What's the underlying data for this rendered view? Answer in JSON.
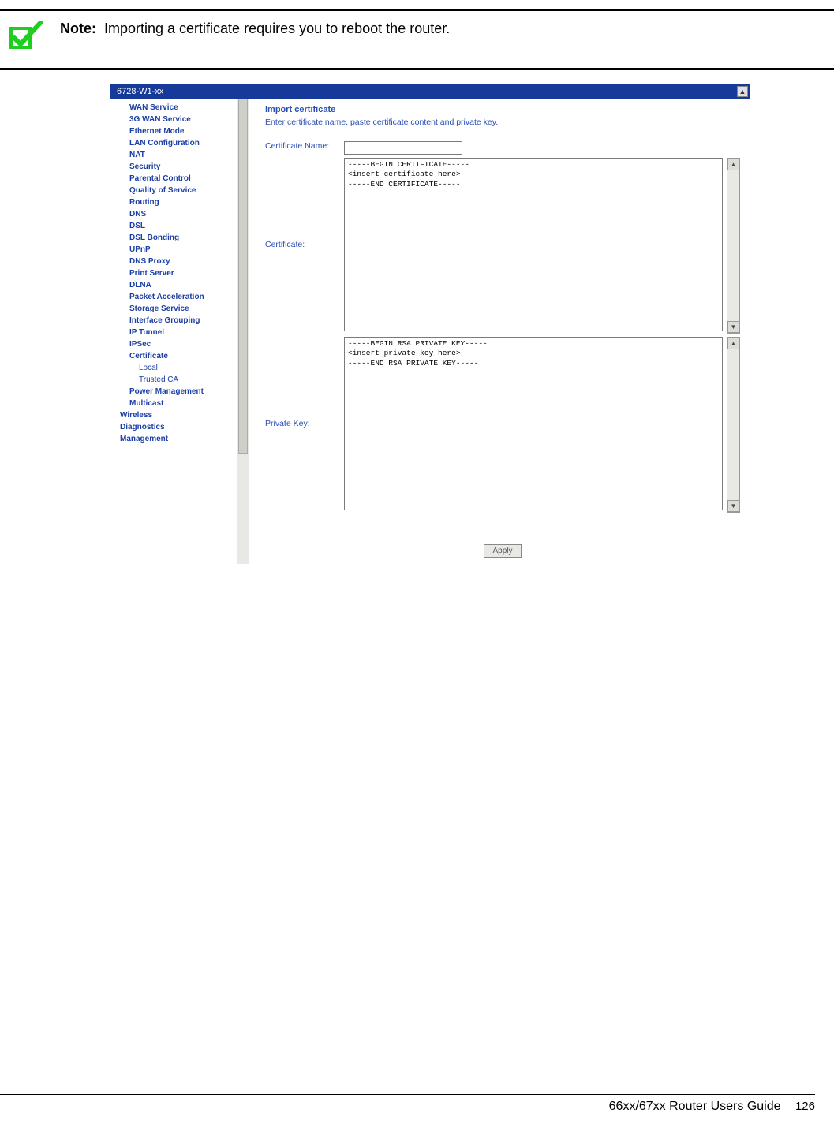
{
  "note": {
    "label": "Note:",
    "text": "Importing a certificate requires you to reboot the router."
  },
  "screenshot": {
    "titlebar": "6728-W1-xx",
    "sidebar": {
      "items": [
        {
          "label": "WAN Service",
          "level": 1
        },
        {
          "label": "3G WAN Service",
          "level": 1
        },
        {
          "label": "Ethernet Mode",
          "level": 1
        },
        {
          "label": "LAN Configuration",
          "level": 1
        },
        {
          "label": "NAT",
          "level": 1
        },
        {
          "label": "Security",
          "level": 1
        },
        {
          "label": "Parental Control",
          "level": 1
        },
        {
          "label": "Quality of Service",
          "level": 1
        },
        {
          "label": "Routing",
          "level": 1
        },
        {
          "label": "DNS",
          "level": 1
        },
        {
          "label": "DSL",
          "level": 1
        },
        {
          "label": "DSL Bonding",
          "level": 1
        },
        {
          "label": "UPnP",
          "level": 1
        },
        {
          "label": "DNS Proxy",
          "level": 1
        },
        {
          "label": "Print Server",
          "level": 1
        },
        {
          "label": "DLNA",
          "level": 1
        },
        {
          "label": "Packet Acceleration",
          "level": 1
        },
        {
          "label": "Storage Service",
          "level": 1
        },
        {
          "label": "Interface Grouping",
          "level": 1
        },
        {
          "label": "IP Tunnel",
          "level": 1
        },
        {
          "label": "IPSec",
          "level": 1
        },
        {
          "label": "Certificate",
          "level": 1
        },
        {
          "label": "Local",
          "level": 2
        },
        {
          "label": "Trusted CA",
          "level": 2
        },
        {
          "label": "Power Management",
          "level": 1
        },
        {
          "label": "Multicast",
          "level": 1
        },
        {
          "label": "Wireless",
          "level": 0
        },
        {
          "label": "Diagnostics",
          "level": 0
        },
        {
          "label": "Management",
          "level": 0
        }
      ]
    },
    "content": {
      "heading": "Import certificate",
      "desc": "Enter certificate name, paste certificate content and private key.",
      "cert_name_label": "Certificate Name:",
      "cert_label": "Certificate:",
      "cert_value": "-----BEGIN CERTIFICATE-----\n<insert certificate here>\n-----END CERTIFICATE-----",
      "pkey_label": "Private Key:",
      "pkey_value": "-----BEGIN RSA PRIVATE KEY-----\n<insert private key here>\n-----END RSA PRIVATE KEY-----",
      "apply_label": "Apply"
    }
  },
  "footer": {
    "guide": "66xx/67xx Router Users Guide",
    "page": "126"
  }
}
